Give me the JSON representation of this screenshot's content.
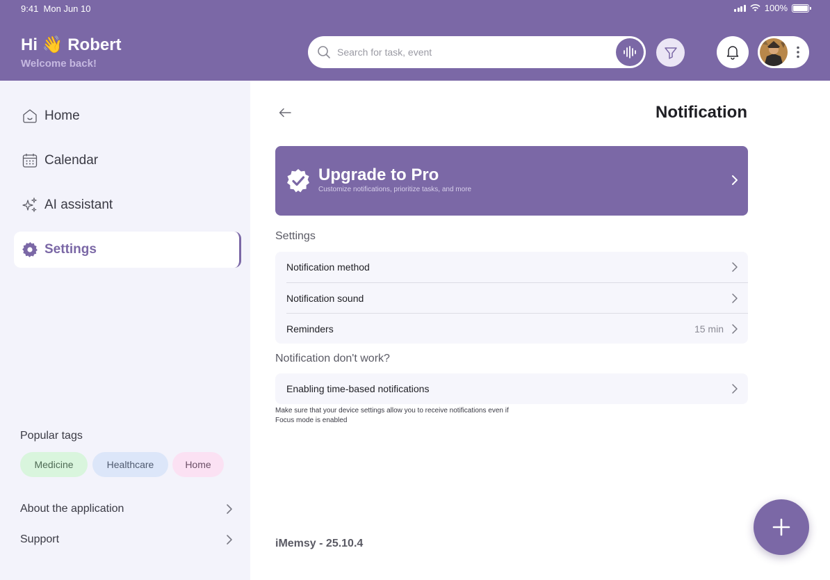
{
  "status_bar": {
    "time": "9:41",
    "date": "Mon Jun 10",
    "battery": "100%"
  },
  "header": {
    "greeting": "Hi 👋 Robert",
    "welcome": "Welcome back!",
    "search_placeholder": "Search for task, event"
  },
  "sidebar": {
    "items": [
      {
        "label": "Home",
        "icon": "home-icon"
      },
      {
        "label": "Calendar",
        "icon": "calendar-icon"
      },
      {
        "label": "AI assistant",
        "icon": "sparkles-icon"
      },
      {
        "label": "Settings",
        "icon": "gear-icon",
        "active": true
      }
    ],
    "popular_tags_title": "Popular tags",
    "tags": [
      "Medicine",
      "Healthcare",
      "Home"
    ],
    "links": [
      "About the application",
      "Support"
    ]
  },
  "main": {
    "title": "Notification",
    "pro_banner": {
      "title": "Upgrade to Pro",
      "subtitle": "Customize notifications, prioritize tasks, and more"
    },
    "settings_section": {
      "title": "Settings",
      "rows": [
        {
          "label": "Notification method",
          "value": ""
        },
        {
          "label": "Notification sound",
          "value": ""
        },
        {
          "label": "Reminders",
          "value": "15 min"
        }
      ]
    },
    "help_section": {
      "title": "Notification don't work?",
      "rows": [
        {
          "label": "Enabling time-based notifications"
        }
      ],
      "note": "Make sure that your device settings allow you to receive notifications even if Focus mode is enabled"
    },
    "version": "iMemsy - 25.10.4"
  },
  "colors": {
    "accent": "#7b68a6",
    "sidebar_bg": "#f3f3fb"
  }
}
